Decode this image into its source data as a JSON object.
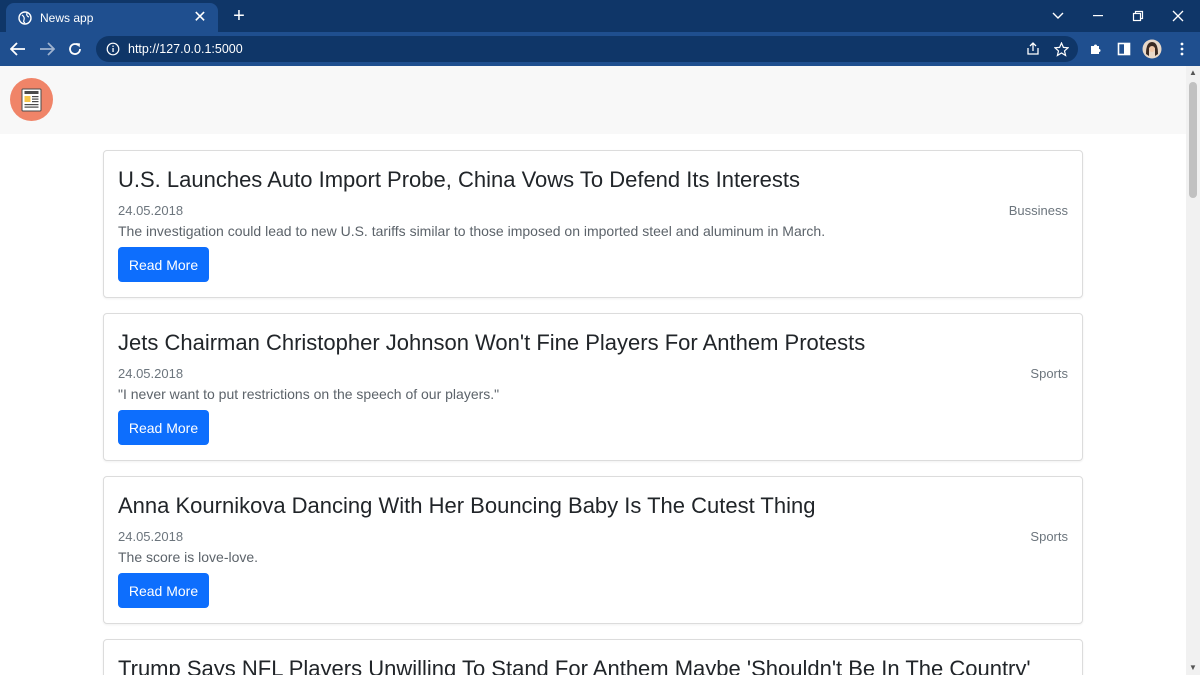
{
  "browser": {
    "tab_title": "News app",
    "tab_close": "✕",
    "new_tab": "+",
    "url_host": "http://127.0.0.1",
    "url_port": ":5000"
  },
  "articles": [
    {
      "title": "U.S. Launches Auto Import Probe, China Vows To Defend Its Interests",
      "date": "24.05.2018",
      "category": "Bussiness",
      "description": "The investigation could lead to new U.S. tariffs similar to those imposed on imported steel and aluminum in March.",
      "button": "Read More"
    },
    {
      "title": "Jets Chairman Christopher Johnson Won't Fine Players For Anthem Protests",
      "date": "24.05.2018",
      "category": "Sports",
      "description": "\"I never want to put restrictions on the speech of our players.\"",
      "button": "Read More"
    },
    {
      "title": "Anna Kournikova Dancing With Her Bouncing Baby Is The Cutest Thing",
      "date": "24.05.2018",
      "category": "Sports",
      "description": "The score is love-love.",
      "button": "Read More"
    },
    {
      "title": "Trump Says NFL Players Unwilling To Stand For Anthem Maybe 'Shouldn't Be In The Country'"
    }
  ],
  "colors": {
    "chrome_dark": "#0f3668",
    "chrome_toolbar": "#1f4f8f",
    "button_blue": "#0d6efd",
    "logo_bg": "#f08468"
  }
}
